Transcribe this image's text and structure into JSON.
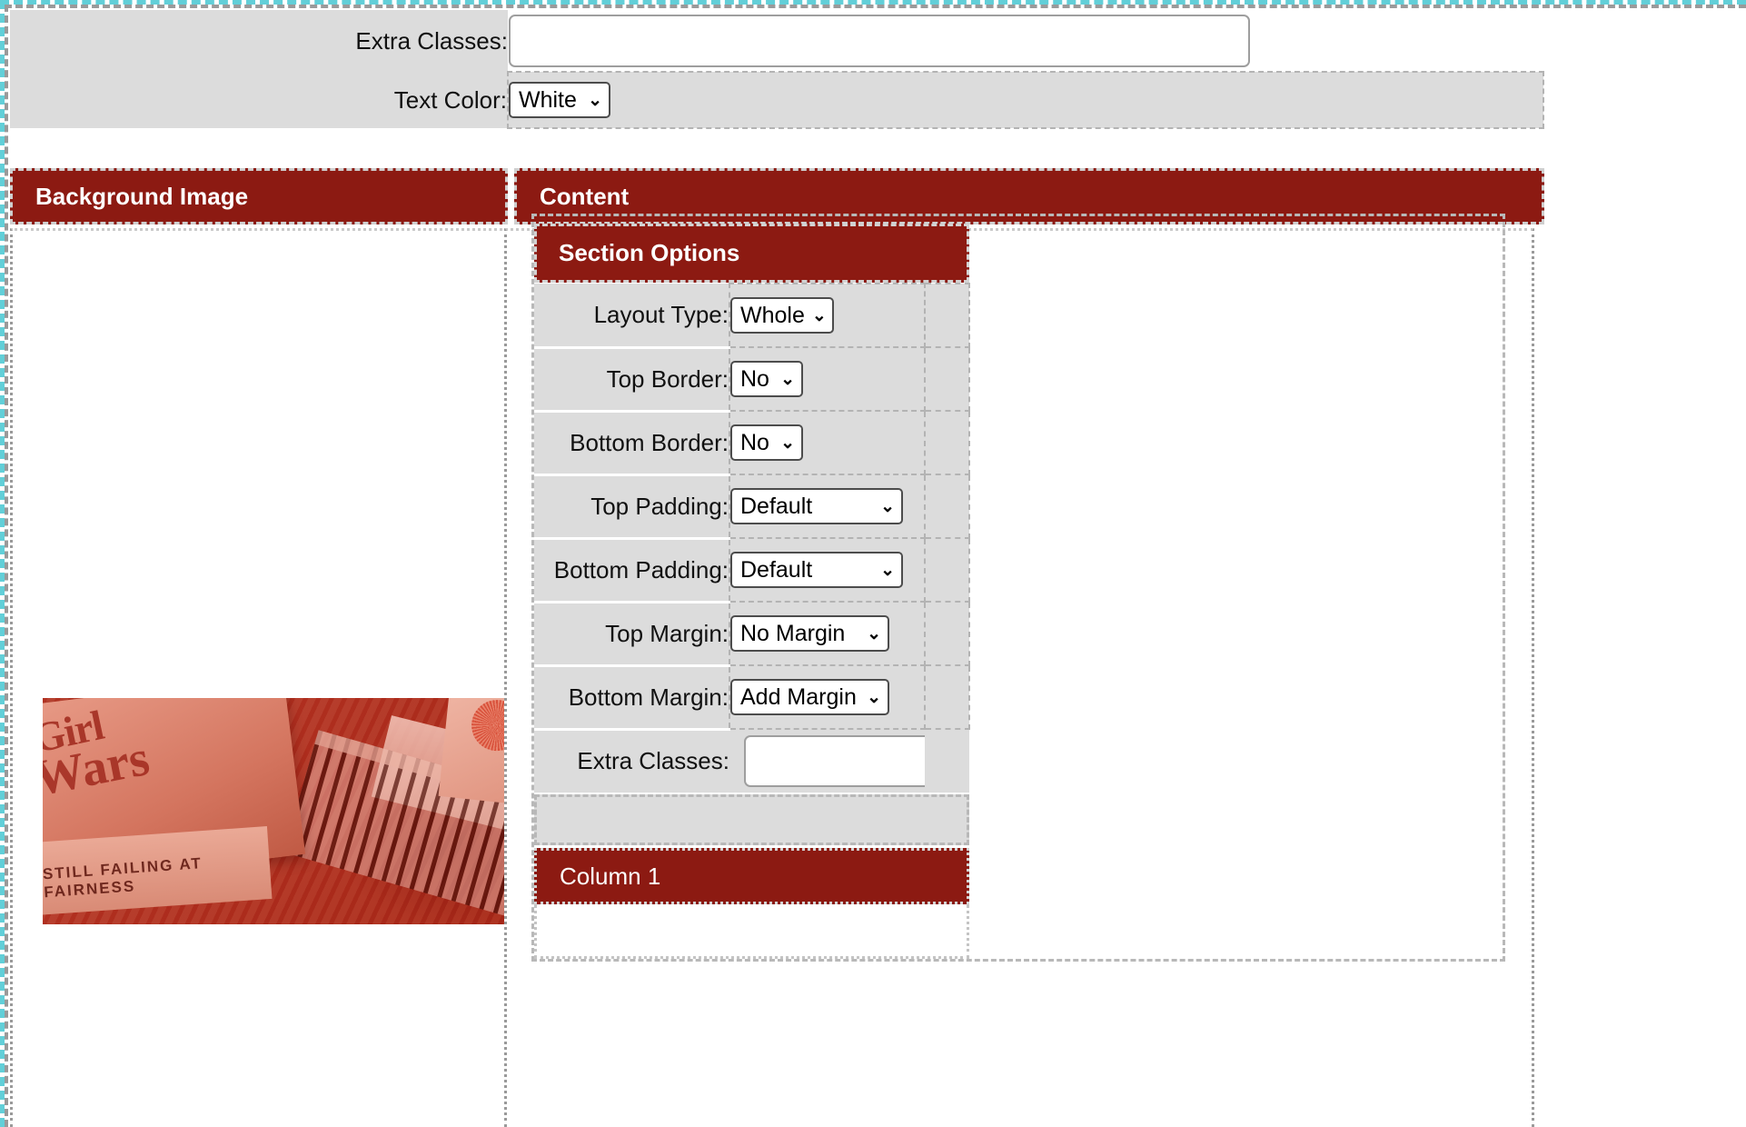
{
  "theme": {
    "accent_red": "#8c1a12",
    "label_bg": "#dcdcdc",
    "selection_teal": "#62cfd8"
  },
  "top_form": {
    "rows": [
      {
        "label": "Extra Classes:",
        "control": "text",
        "value": "",
        "placeholder": ""
      },
      {
        "label": "Text Color:",
        "control": "select",
        "value": "White"
      }
    ]
  },
  "region_headers": {
    "background_image": "Background Image",
    "content": "Content"
  },
  "background_image_panel": {
    "thumbnail_alt": "books-photo-thumbnail",
    "book_titles": {
      "title_line1": "Girl",
      "title_line2": "Wars",
      "title_line3": "STILL FAILING AT FAIRNESS"
    }
  },
  "section_options": {
    "title": "Section Options",
    "rows": [
      {
        "label": "Layout Type:",
        "control": "select",
        "value": "Whole",
        "width_class": "w-whole"
      },
      {
        "label": "Top Border:",
        "control": "select",
        "value": "No",
        "width_class": "w-no"
      },
      {
        "label": "Bottom Border:",
        "control": "select",
        "value": "No",
        "width_class": "w-no"
      },
      {
        "label": "Top Padding:",
        "control": "select",
        "value": "Default",
        "width_class": "w-default"
      },
      {
        "label": "Bottom Padding:",
        "control": "select",
        "value": "Default",
        "width_class": "w-default"
      },
      {
        "label": "Top Margin:",
        "control": "select",
        "value": "No Margin",
        "width_class": "w-margin"
      },
      {
        "label": "Bottom Margin:",
        "control": "select",
        "value": "Add Margin",
        "width_class": "w-margin"
      },
      {
        "label": "Extra Classes:",
        "control": "text",
        "value": "",
        "width_class": ""
      }
    ]
  },
  "column_block": {
    "title": "Column 1"
  },
  "icons": {
    "caret_down": "⌄"
  }
}
